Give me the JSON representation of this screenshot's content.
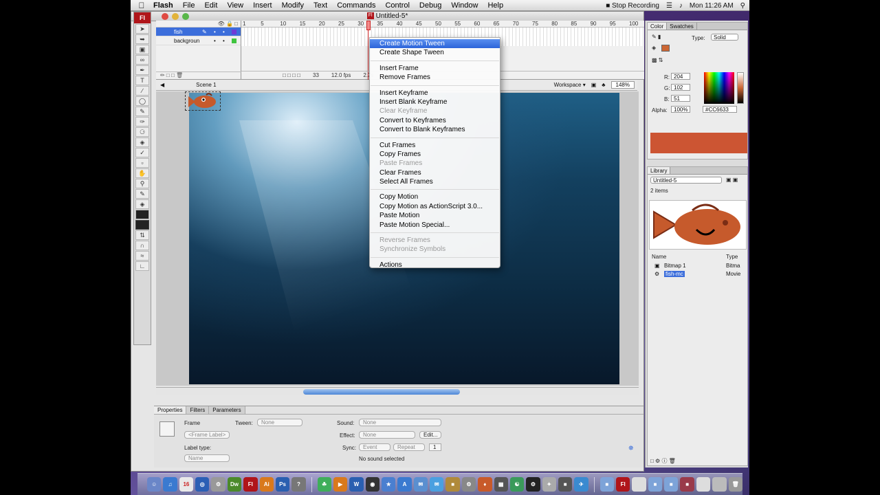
{
  "menubar": {
    "items": [
      "Flash",
      "File",
      "Edit",
      "View",
      "Insert",
      "Modify",
      "Text",
      "Commands",
      "Control",
      "Debug",
      "Window",
      "Help"
    ],
    "stop_recording": "Stop Recording",
    "clock": "Mon 11:26 AM"
  },
  "window": {
    "title": "Untitled-5*"
  },
  "tools": {
    "logo": "Fl"
  },
  "timeline": {
    "layers": [
      {
        "name": "fish",
        "color": "#6e3bd6"
      },
      {
        "name": "backgroun",
        "color": "#3fc43f"
      }
    ],
    "ticks": [
      "1",
      "5",
      "10",
      "15",
      "20",
      "25",
      "30",
      "35",
      "40",
      "45",
      "50",
      "55",
      "60",
      "65",
      "70",
      "75",
      "80",
      "85",
      "90",
      "95",
      "100"
    ],
    "current_frame": "33",
    "fps": "12.0 fps",
    "time": "2.7s"
  },
  "editbar": {
    "scene": "Scene 1",
    "workspace": "Workspace ▾",
    "zoom": "148%"
  },
  "context_menu": {
    "groups": [
      [
        {
          "label": "Create Motion Tween",
          "state": "highlighted"
        },
        {
          "label": "Create Shape Tween",
          "state": "enabled"
        }
      ],
      [
        {
          "label": "Insert Frame",
          "state": "enabled"
        },
        {
          "label": "Remove Frames",
          "state": "enabled"
        }
      ],
      [
        {
          "label": "Insert Keyframe",
          "state": "enabled"
        },
        {
          "label": "Insert Blank Keyframe",
          "state": "enabled"
        },
        {
          "label": "Clear Keyframe",
          "state": "disabled"
        },
        {
          "label": "Convert to Keyframes",
          "state": "enabled"
        },
        {
          "label": "Convert to Blank Keyframes",
          "state": "enabled"
        }
      ],
      [
        {
          "label": "Cut Frames",
          "state": "enabled"
        },
        {
          "label": "Copy Frames",
          "state": "enabled"
        },
        {
          "label": "Paste Frames",
          "state": "disabled"
        },
        {
          "label": "Clear Frames",
          "state": "enabled"
        },
        {
          "label": "Select All Frames",
          "state": "enabled"
        }
      ],
      [
        {
          "label": "Copy Motion",
          "state": "enabled"
        },
        {
          "label": "Copy Motion as ActionScript 3.0...",
          "state": "enabled"
        },
        {
          "label": "Paste Motion",
          "state": "enabled"
        },
        {
          "label": "Paste Motion Special...",
          "state": "enabled"
        }
      ],
      [
        {
          "label": "Reverse Frames",
          "state": "disabled"
        },
        {
          "label": "Synchronize Symbols",
          "state": "disabled"
        }
      ],
      [
        {
          "label": "Actions",
          "state": "enabled"
        }
      ]
    ]
  },
  "properties": {
    "tabs": [
      "Properties",
      "Filters",
      "Parameters"
    ],
    "frame_label": "Frame",
    "frame_label_placeholder": "<Frame Label>",
    "tween_label": "Tween:",
    "tween_value": "None",
    "label_type_label": "Label type:",
    "label_type_value": "Name",
    "sound_label": "Sound:",
    "sound_value": "None",
    "effect_label": "Effect:",
    "effect_value": "None",
    "edit_button": "Edit...",
    "sync_label": "Sync:",
    "sync_value": "Event",
    "repeat_value": "Repeat",
    "repeat_count": "1",
    "no_sound": "No sound selected"
  },
  "color_panel": {
    "tabs": [
      "Color",
      "Swatches"
    ],
    "type_label": "Type:",
    "type_value": "Solid",
    "r_label": "R:",
    "r_value": "204",
    "g_label": "G:",
    "g_value": "102",
    "b_label": "B:",
    "b_value": "51",
    "alpha_label": "Alpha:",
    "alpha_value": "100%",
    "hex_value": "#CC6633",
    "swatch_color": "#CC6633"
  },
  "library": {
    "tab": "Library",
    "document": "Untitled-5",
    "count": "2 items",
    "col_name": "Name",
    "col_type": "Type",
    "items": [
      {
        "name": "Bitmap 1",
        "type": "Bitma"
      },
      {
        "name": "fish-mc",
        "type": "Movie"
      }
    ]
  },
  "dock": {
    "apps": [
      {
        "label": "16",
        "color": "#e9e9e9"
      },
      {
        "label": "Dw",
        "color": "#4b8a2a"
      },
      {
        "label": "Fl",
        "color": "#b0151a"
      },
      {
        "label": "Ai",
        "color": "#d9791c"
      },
      {
        "label": "Ps",
        "color": "#2a5fb0"
      }
    ]
  }
}
